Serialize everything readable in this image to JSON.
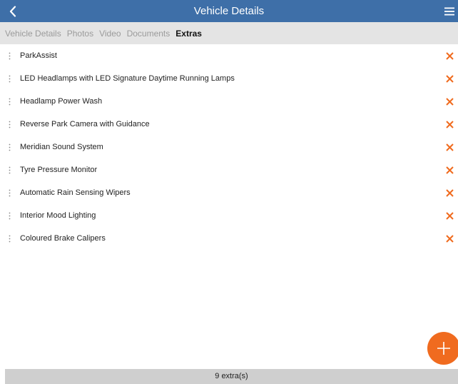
{
  "header": {
    "title": "Vehicle Details",
    "background": "#3e6fa8",
    "back_icon": "chevron-left-icon",
    "menu_icon": "hamburger-menu-icon"
  },
  "tabs": [
    {
      "label": "Vehicle Details",
      "active": false
    },
    {
      "label": "Photos",
      "active": false
    },
    {
      "label": "Video",
      "active": false
    },
    {
      "label": "Documents",
      "active": false
    },
    {
      "label": "Extras",
      "active": true
    }
  ],
  "extras": {
    "items": [
      {
        "label": "ParkAssist"
      },
      {
        "label": "LED Headlamps with LED Signature Daytime Running Lamps"
      },
      {
        "label": "Headlamp Power Wash"
      },
      {
        "label": "Reverse Park Camera with Guidance"
      },
      {
        "label": "Meridian Sound System"
      },
      {
        "label": "Tyre Pressure Monitor"
      },
      {
        "label": "Automatic Rain Sensing Wipers"
      },
      {
        "label": "Interior Mood Lighting"
      },
      {
        "label": "Coloured Brake Calipers"
      }
    ],
    "drag_icon": "drag-handle-icon",
    "remove_icon": "close-icon",
    "remove_color": "#f06b1f"
  },
  "fab": {
    "icon": "plus-icon",
    "color": "#f06b1f"
  },
  "footer": {
    "count_text": "9 extra(s)"
  }
}
